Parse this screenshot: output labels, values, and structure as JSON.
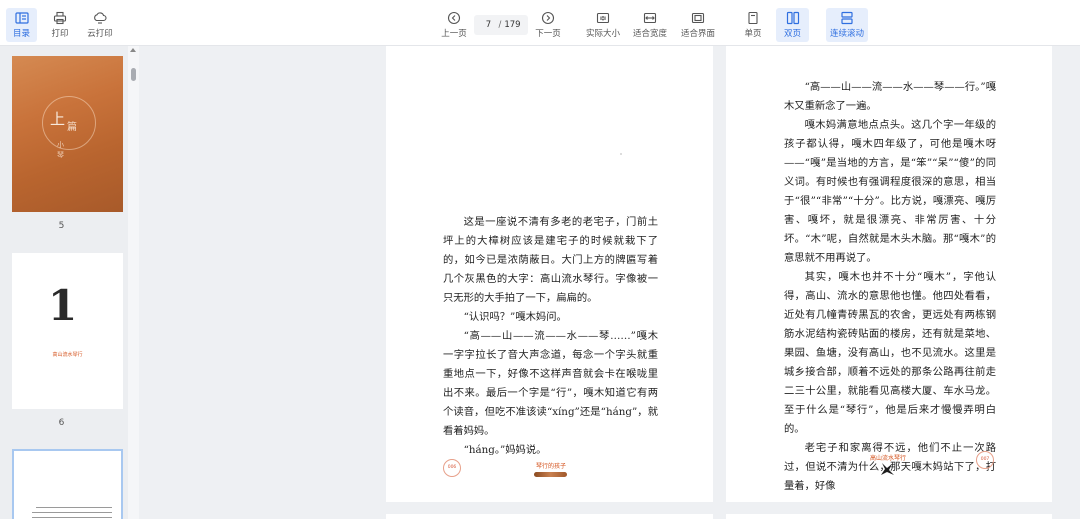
{
  "toolbar": {
    "left": [
      {
        "label": "目录",
        "icon": "toc-icon",
        "active": true
      },
      {
        "label": "打印",
        "icon": "print-icon"
      },
      {
        "label": "云打印",
        "icon": "cloud-print-icon"
      }
    ],
    "prev_label": "上一页",
    "next_label": "下一页",
    "current_page": "7",
    "total_pages": "179",
    "page_separator": "/",
    "actual_size": "实际大小",
    "fit_width": "适合宽度",
    "fit_page": "适合界面",
    "single_page": "单页",
    "double_page": "双页",
    "continuous_scroll": "连续滚动",
    "accent_color": "#2f6fe0"
  },
  "sidebar": {
    "thumbnails": [
      {
        "page_label": "5",
        "title_big": "上",
        "title_big2": "篇",
        "subtitle": "小",
        "subtitle2": "琴"
      },
      {
        "page_label": "6",
        "numeral": "1",
        "caption": "高山流水琴行"
      },
      {
        "page_label": "",
        "selected": true
      }
    ]
  },
  "left_page": {
    "paragraphs": [
      "这是一座说不清有多老的老宅子，门前土坪上的大樟树应该是建宅子的时候就栽下了的，如今已是浓荫蔽日。大门上方的牌匾写着几个灰黑色的大字：高山流水琴行。字像被一只无形的大手拍了一下，扁扁的。",
      "“认识吗？”嘎木妈问。",
      "“高——山——流——水——琴……”嘎木一字字拉长了音大声念道，每念一个字头就重重地点一下，好像不这样声音就会卡在喉咙里出不来。最后一个字是“行”，嘎木知道它有两个读音，但吃不准该读“xíng”还是“háng”，就看着妈妈。",
      "“háng。”妈妈说。"
    ],
    "page_number": "006",
    "footer_title": "琴行的孩子"
  },
  "right_page": {
    "paragraphs": [
      "“高——山——流——水——琴——行。”嘎木又重新念了一遍。",
      "嘎木妈满意地点点头。这几个字一年级的孩子都认得，嘎木四年级了，可他是嘎木呀——“嘎”是当地的方言，是“笨”“呆”“傻”的同义词。有时候也有强调程度很深的意思，相当于“很”“非常”“十分”。比方说，嘎漂亮、嘎厉害、嘎坏，就是很漂亮、非常厉害、十分坏。“木”呢，自然就是木头木脑。那“嘎木”的意思就不用再说了。",
      "其实，嘎木也并不十分“嘎木”，字他认得，高山、流水的意思他也懂。他四处看看，近处有几幢青砖黑瓦的农舍，更远处有两栋钢筋水泥结构瓷砖贴面的楼房，还有就是菜地、果园、鱼塘，没有高山，也不见流水。这里是城乡接合部，顺着不远处的那条公路再往前走二三十公里，就能看见高楼大厦、车水马龙。至于什么是“琴行”，他是后来才慢慢弄明白的。",
      "老宅子和家离得不远，他们不止一次路过，但说不清为什么，那天嘎木妈站下了，打量着，好像"
    ],
    "page_number": "007",
    "footer_title": "高山流水琴行"
  }
}
